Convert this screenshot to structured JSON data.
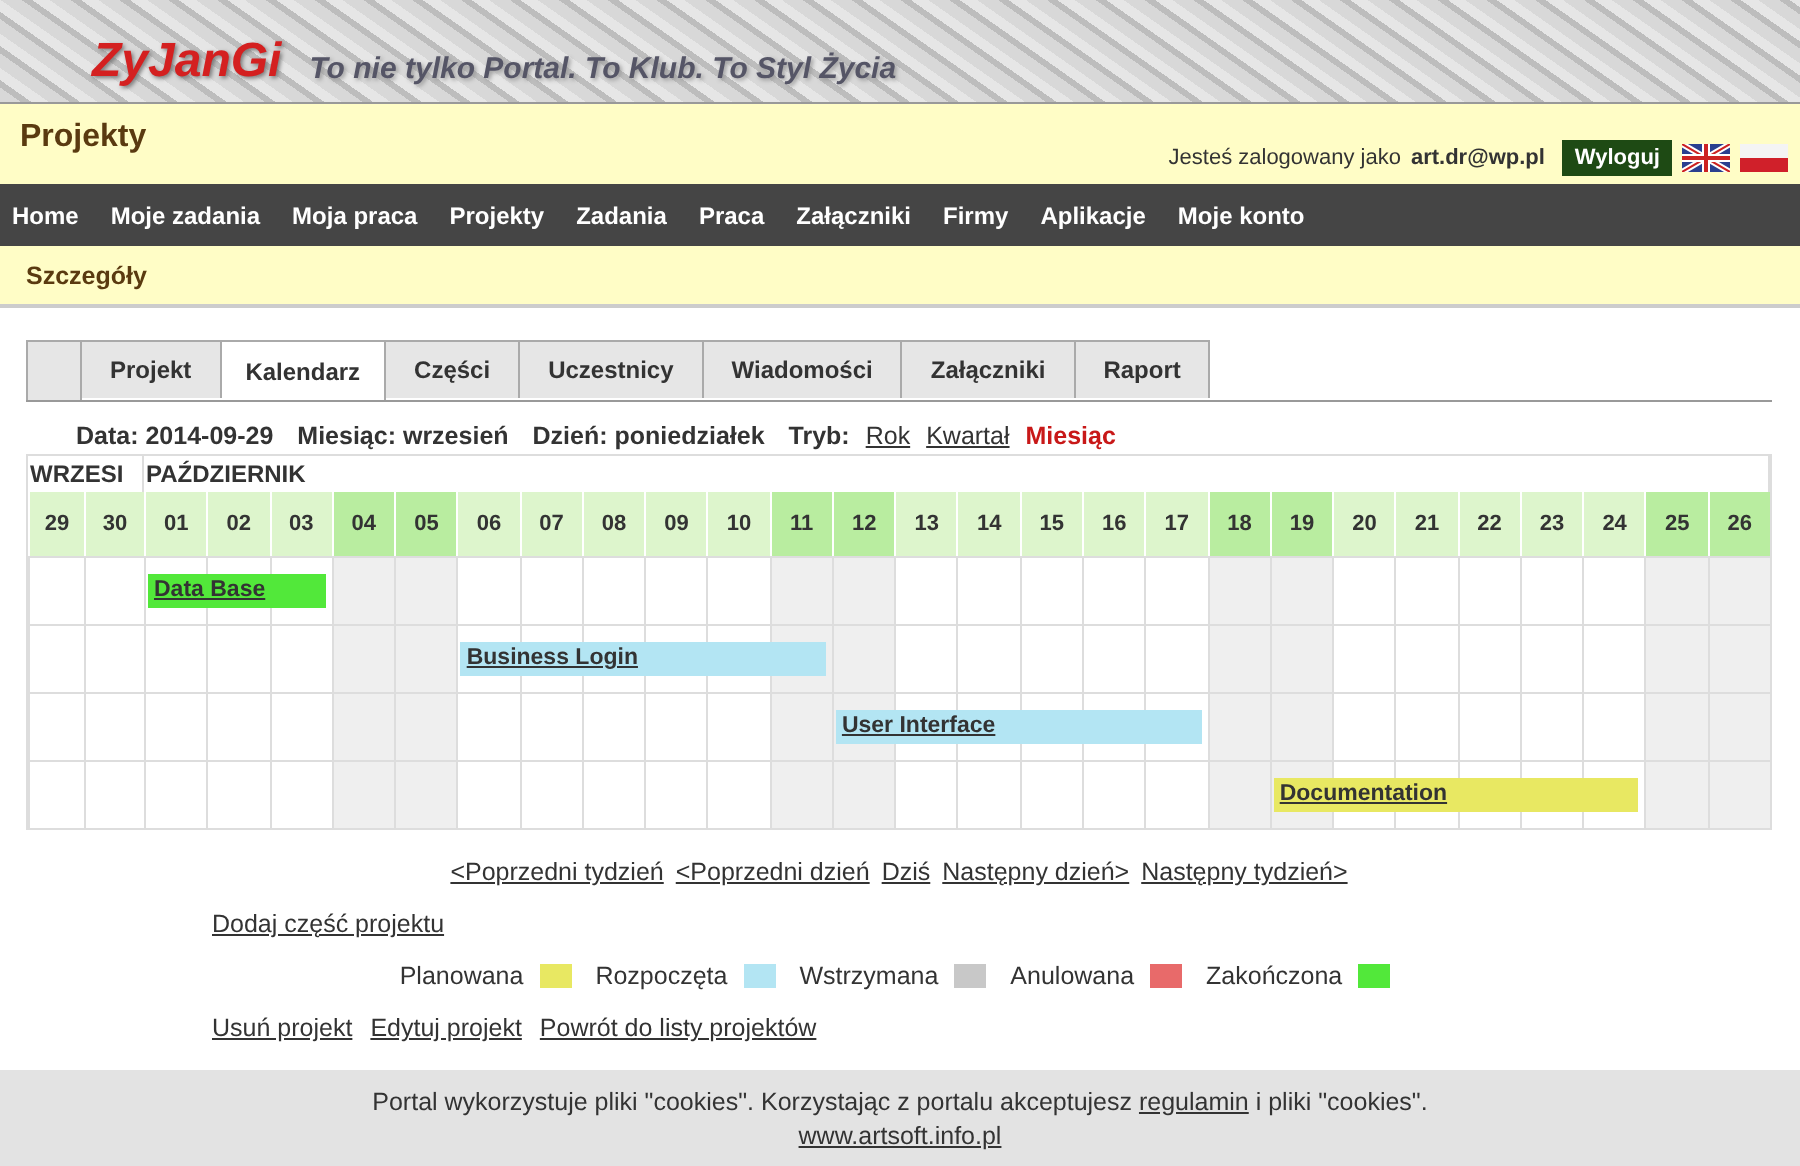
{
  "header": {
    "logo": "ZyJanGi",
    "tagline": "To nie tylko Portal. To Klub. To Styl Życia"
  },
  "title_bar": {
    "title": "Projekty",
    "login_text": "Jesteś zalogowany jako",
    "user": "art.dr@wp.pl",
    "logout": "Wyloguj"
  },
  "nav": [
    "Home",
    "Moje zadania",
    "Moja praca",
    "Projekty",
    "Zadania",
    "Praca",
    "Załączniki",
    "Firmy",
    "Aplikacje",
    "Moje konto"
  ],
  "section": {
    "title": "Szczegóły"
  },
  "tabs": [
    {
      "label": "Projekt",
      "selected": false
    },
    {
      "label": "Kalendarz",
      "selected": true
    },
    {
      "label": "Części",
      "selected": false
    },
    {
      "label": "Uczestnicy",
      "selected": false
    },
    {
      "label": "Wiadomości",
      "selected": false
    },
    {
      "label": "Załączniki",
      "selected": false
    },
    {
      "label": "Raport",
      "selected": false
    }
  ],
  "info": {
    "items": [
      "Data: 2014-09-29",
      "Miesiąc: wrzesień",
      "Dzień: poniedziałek"
    ],
    "mode_label": "Tryb:",
    "modes": [
      {
        "label": "Rok",
        "selected": false
      },
      {
        "label": "Kwartał",
        "selected": false
      },
      {
        "label": "Miesiąc",
        "selected": true
      }
    ]
  },
  "calendar": {
    "months": [
      "WRZESI",
      "PAŹDZIERNIK"
    ],
    "days": [
      {
        "label": "29",
        "weekend": false
      },
      {
        "label": "30",
        "weekend": false
      },
      {
        "label": "01",
        "weekend": false
      },
      {
        "label": "02",
        "weekend": false
      },
      {
        "label": "03",
        "weekend": false
      },
      {
        "label": "04",
        "weekend": true
      },
      {
        "label": "05",
        "weekend": true
      },
      {
        "label": "06",
        "weekend": false
      },
      {
        "label": "07",
        "weekend": false
      },
      {
        "label": "08",
        "weekend": false
      },
      {
        "label": "09",
        "weekend": false
      },
      {
        "label": "10",
        "weekend": false
      },
      {
        "label": "11",
        "weekend": true
      },
      {
        "label": "12",
        "weekend": true
      },
      {
        "label": "13",
        "weekend": false
      },
      {
        "label": "14",
        "weekend": false
      },
      {
        "label": "15",
        "weekend": false
      },
      {
        "label": "16",
        "weekend": false
      },
      {
        "label": "17",
        "weekend": false
      },
      {
        "label": "18",
        "weekend": true
      },
      {
        "label": "19",
        "weekend": true
      },
      {
        "label": "20",
        "weekend": false
      },
      {
        "label": "21",
        "weekend": false
      },
      {
        "label": "22",
        "weekend": false
      },
      {
        "label": "23",
        "weekend": false
      },
      {
        "label": "24",
        "weekend": false
      },
      {
        "label": "25",
        "weekend": true
      },
      {
        "label": "26",
        "weekend": true
      }
    ],
    "tasks": [
      {
        "name": "Data Base",
        "color": "#52e83a"
      },
      {
        "name": "Business Login",
        "color": "#b3e5f3"
      },
      {
        "name": "User Interface",
        "color": "#b3e5f3"
      },
      {
        "name": "Documentation",
        "color": "#e8e862"
      }
    ]
  },
  "pager": [
    "<Poprzedni tydzień",
    "<Poprzedni dzień",
    "Dziś",
    "Następny dzień>",
    "Następny tydzień>"
  ],
  "add_link": "Dodaj część projektu",
  "legend": [
    {
      "label": "Planowana",
      "color": "#e8e862"
    },
    {
      "label": "Rozpoczęta",
      "color": "#b3e5f3"
    },
    {
      "label": "Wstrzymana",
      "color": "#c8c8c8"
    },
    {
      "label": "Anulowana",
      "color": "#e86a6a"
    },
    {
      "label": "Zakończona",
      "color": "#52e83a"
    }
  ],
  "actions": [
    "Usuń projekt",
    "Edytuj projekt",
    "Powrót do listy projektów"
  ],
  "footer": {
    "before": "Portal wykorzystuje pliki \"cookies\". Korzystając z portalu akceptujesz",
    "link": "regulamin",
    "after": "i pliki \"cookies\".",
    "site": "www.artsoft.info.pl"
  }
}
